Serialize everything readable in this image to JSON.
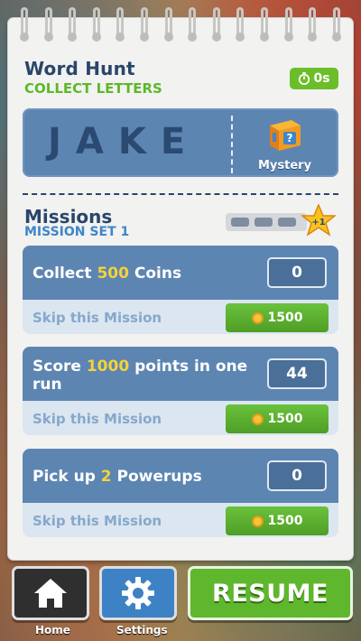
{
  "header": {
    "title": "Word Hunt",
    "subtitle": "COLLECT LETTERS",
    "timer": "0s"
  },
  "word_hunt": {
    "word": "JAKE",
    "reward_label": "Mystery"
  },
  "missions": {
    "title": "Missions",
    "set_label": "MISSION SET 1",
    "multiplier_badge": "+1",
    "multiplier_progress": 0,
    "items": [
      {
        "text_before": "Collect ",
        "highlight": "500",
        "text_after": " Coins",
        "progress": "0",
        "skip_label": "Skip this Mission",
        "cost": "1500"
      },
      {
        "text_before": "Score ",
        "highlight": "1000",
        "text_after": " points in one run",
        "progress": "44",
        "skip_label": "Skip this Mission",
        "cost": "1500"
      },
      {
        "text_before": "Pick up ",
        "highlight": "2",
        "text_after": " Powerups",
        "progress": "0",
        "skip_label": "Skip this Mission",
        "cost": "1500"
      }
    ]
  },
  "footer": {
    "home_label": "Home",
    "settings_label": "Settings",
    "resume_label": "RESUME"
  },
  "colors": {
    "panel_blue": "#5d85b2",
    "title_navy": "#28466a",
    "accent_green": "#5fb72d",
    "highlight_yellow": "#f4d23a"
  }
}
